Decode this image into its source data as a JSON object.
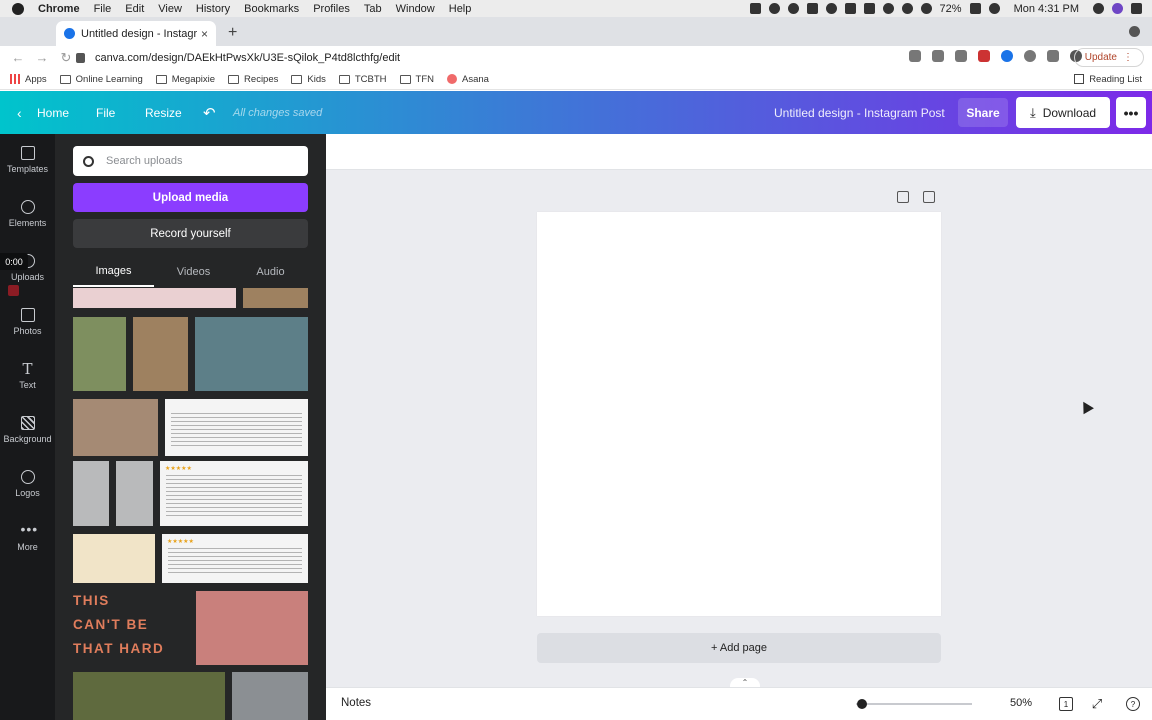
{
  "mac_menu": {
    "app": "Chrome",
    "items": [
      "File",
      "Edit",
      "View",
      "History",
      "Bookmarks",
      "Profiles",
      "Tab",
      "Window",
      "Help"
    ],
    "battery": "72%",
    "clock": "Mon 4:31 PM"
  },
  "browser": {
    "tab_title": "Untitled design - Instagram Po",
    "url": "canva.com/design/DAEkHtPwsXk/U3E-sQilok_P4td8lcthfg/edit",
    "update_label": "Update",
    "bookmarks": [
      "Apps",
      "Online Learning",
      "Megapixie",
      "Recipes",
      "Kids",
      "TCBTH",
      "TFN",
      "Asana"
    ],
    "reading_list": "Reading List"
  },
  "header": {
    "home": "Home",
    "file": "File",
    "resize": "Resize",
    "saved_status": "All changes saved",
    "doc_title": "Untitled design - Instagram Post",
    "share": "Share",
    "download": "Download",
    "more": "•••"
  },
  "rail": {
    "templates": "Templates",
    "elements": "Elements",
    "uploads": "Uploads",
    "photos": "Photos",
    "text": "Text",
    "background": "Background",
    "logos": "Logos",
    "more": "More",
    "timer": "0:00"
  },
  "uploads": {
    "search_placeholder": "Search uploads",
    "upload_media": "Upload media",
    "record_yourself": "Record yourself",
    "tabs": [
      "Images",
      "Videos",
      "Audio"
    ],
    "quote_lines": [
      "THIS",
      "CAN'T BE",
      "THAT HARD"
    ],
    "rating": "★★★★★"
  },
  "editor": {
    "add_page": "+ Add page",
    "notes": "Notes",
    "zoom": "50%",
    "page_count": "1",
    "help": "?"
  },
  "colors": {
    "header_gradient_start": "#00c4cc",
    "header_gradient_end": "#7d2ae8",
    "upload_button": "#8b3dff",
    "panel_bg": "#252627",
    "rail_bg": "#18191b"
  }
}
